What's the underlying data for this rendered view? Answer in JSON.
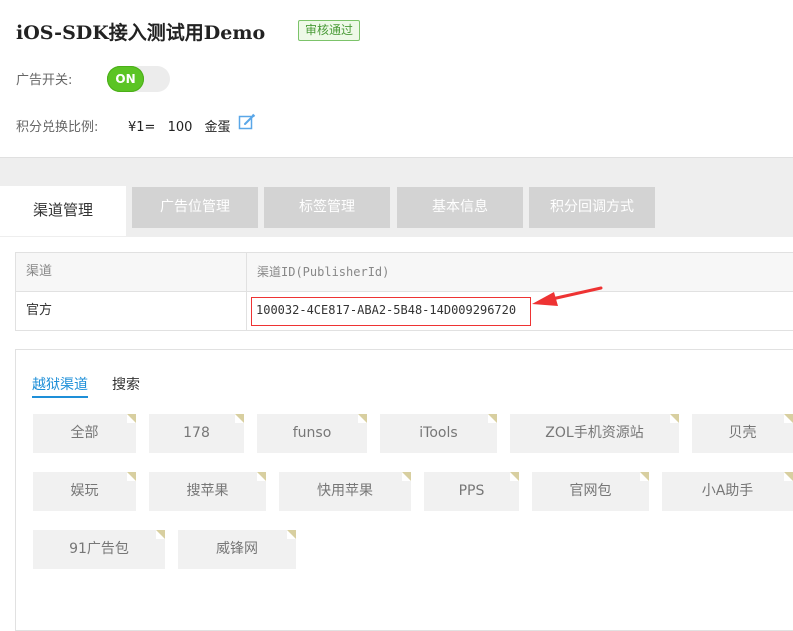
{
  "header": {
    "title": "iOS-SDK接入测试用Demo",
    "status_badge": "审核通过"
  },
  "ad_switch": {
    "label": "广告开关:",
    "state": "ON"
  },
  "ratio": {
    "label": "积分兑换比例:",
    "currency": "¥1=",
    "amount": "100",
    "unit": "金蛋"
  },
  "tabs": [
    {
      "label": "渠道管理",
      "active": true
    },
    {
      "label": "广告位管理",
      "active": false
    },
    {
      "label": "标签管理",
      "active": false
    },
    {
      "label": "基本信息",
      "active": false
    },
    {
      "label": "积分回调方式",
      "active": false
    }
  ],
  "table": {
    "headers": [
      "渠道",
      "渠道ID(PublisherId)"
    ],
    "rows": [
      {
        "channel": "官方",
        "publisher_id": "100032-4CE817-ABA2-5B48-14D009296720"
      }
    ]
  },
  "channel_panel": {
    "subtabs": [
      "越狱渠道",
      "搜索"
    ],
    "chips": [
      "全部",
      "178",
      "funso",
      "iTools",
      "ZOL手机资源站",
      "贝壳",
      "娱玩",
      "搜苹果",
      "快用苹果",
      "PPS",
      "官网包",
      "小A助手",
      "91广告包",
      "威锋网"
    ]
  },
  "colors": {
    "toggle_on": "#5bc424",
    "active_tab_link": "#1e8fd8",
    "highlight_box": "#ee3333",
    "badge_green": "#7cc36a"
  }
}
